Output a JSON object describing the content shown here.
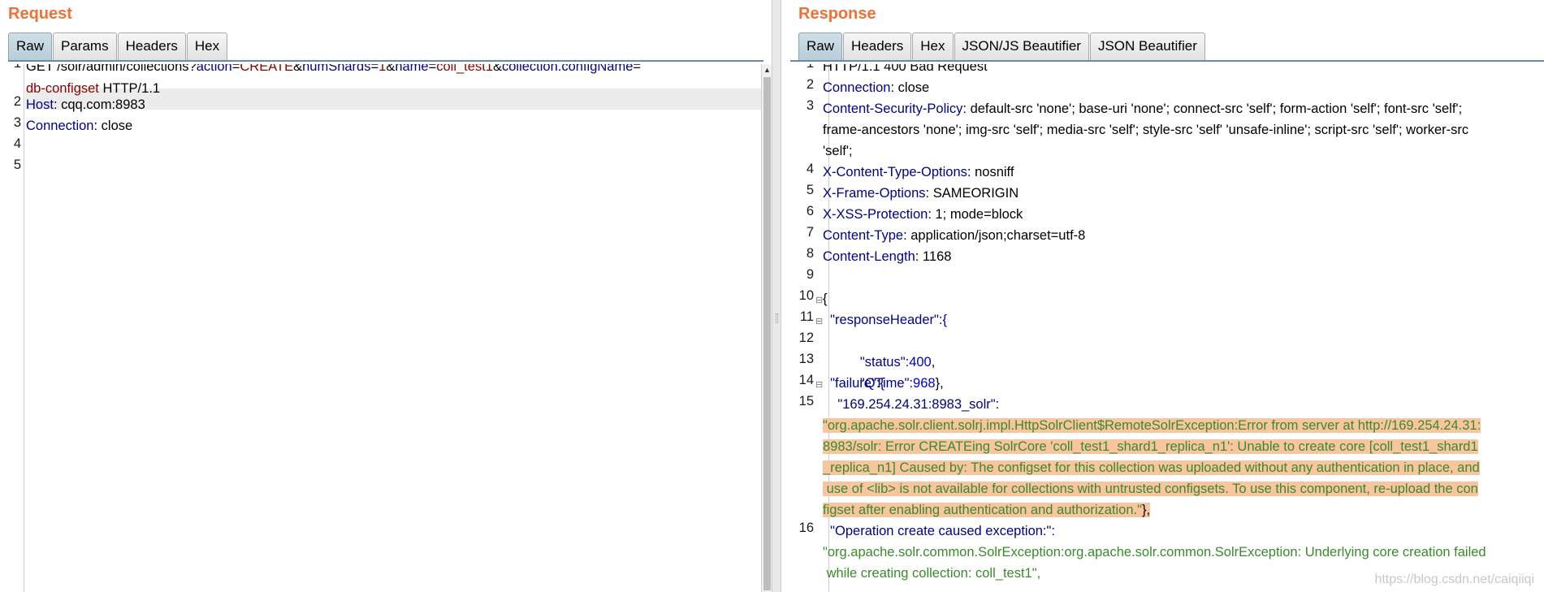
{
  "request": {
    "title": "Request",
    "tabs": [
      "Raw",
      "Params",
      "Headers",
      "Hex"
    ],
    "active_tab": "Raw",
    "line_numbers": [
      "1",
      "2",
      "3",
      "4",
      "5"
    ],
    "line1": {
      "method_path": "GET /solr/admin/collections?",
      "p1_key": "action",
      "p1_eq": "=",
      "p1_val": "CREATE",
      "amp1": "&",
      "p2_key": "numShards",
      "p2_eq": "=",
      "p2_val": "1",
      "amp2": "&",
      "p3_key": "name",
      "p3_eq": "=",
      "p3_val": "coll_test1",
      "amp3": "&",
      "p4_key": "collection.configName",
      "p4_eq": "="
    },
    "line1_wrap": {
      "p4_val": "db-configset",
      "proto": " HTTP/1.1"
    },
    "line2": {
      "key": "Host",
      "sep": ": ",
      "val": "cqq.com:8983"
    },
    "line3": {
      "key": "Connection",
      "sep": ": ",
      "val": "close"
    }
  },
  "response": {
    "title": "Response",
    "tabs": [
      "Raw",
      "Headers",
      "Hex",
      "JSON/JS Beautifier",
      "JSON Beautifier"
    ],
    "active_tab": "Raw",
    "line_numbers": [
      "1",
      "2",
      "3",
      "4",
      "5",
      "6",
      "7",
      "8",
      "9",
      "10",
      "11",
      "12",
      "13",
      "14",
      "15",
      "16"
    ],
    "fold_marker": "⊟",
    "status_line": "HTTP/1.1 400 Bad Request",
    "headers": {
      "connection": {
        "key": "Connection",
        "val": ": close"
      },
      "csp": {
        "key": "Content-Security-Policy",
        "val1": ": default-src 'none'; base-uri 'none'; connect-src 'self'; form-action 'self'; font-src 'self';",
        "val2": "frame-ancestors 'none'; img-src 'self'; media-src 'self'; style-src 'self' 'unsafe-inline'; script-src 'self'; worker-src",
        "val3": "'self';"
      },
      "xcto": {
        "key": "X-Content-Type-Options",
        "val": ": nosniff"
      },
      "xfo": {
        "key": "X-Frame-Options",
        "val": ": SAMEORIGIN"
      },
      "xxss": {
        "key": "X-XSS-Protection",
        "val": ": 1; mode=block"
      },
      "ctype": {
        "key": "Content-Type",
        "val": ": application/json;charset=utf-8"
      },
      "clen": {
        "key": "Content-Length",
        "val": ": 1168"
      }
    },
    "body": {
      "open_brace": "{",
      "response_header_key": "  \"responseHeader\":{",
      "status_key": "    \"status\":",
      "status_val": "400",
      "status_comma": ",",
      "qtime_key": "    \"QTime\":",
      "qtime_val": "968",
      "qtime_close": "},",
      "failure_key": "  \"failure\":{",
      "failure_node_key": "    \"169.254.24.31:8983_solr\":",
      "failure_msg_1": "\"org.apache.solr.client.solrj.impl.HttpSolrClient$RemoteSolrException:Error from server at http://169.254.24.31:",
      "failure_msg_2": "8983/solr: Error CREATEing SolrCore 'coll_test1_shard1_replica_n1': Unable to create core [coll_test1_shard1",
      "failure_msg_3": "_replica_n1] Caused by: The configset for this collection was uploaded without any authentication in place, and",
      "failure_msg_4": " use of <lib> is not available for collections with untrusted configsets. To use this component, re-upload the con",
      "failure_msg_5": "figset after enabling authentication and authorization.\"",
      "failure_msg_close": "},",
      "op_key": "  \"Operation create caused exception:\":",
      "op_msg_1": "\"org.apache.solr.common.SolrException:org.apache.solr.common.SolrException: Underlying core creation failed",
      "op_msg_2": " while creating collection: coll_test1\","
    }
  },
  "watermark": "https://blog.csdn.net/caiqiiqi",
  "colors": {
    "title_orange": "#f26f35",
    "header_key": "#00008b",
    "param_value": "#8b0000",
    "json_string": "#3a8a2c",
    "json_number": "#0000cd",
    "highlight_orange": "#f8c59f"
  }
}
